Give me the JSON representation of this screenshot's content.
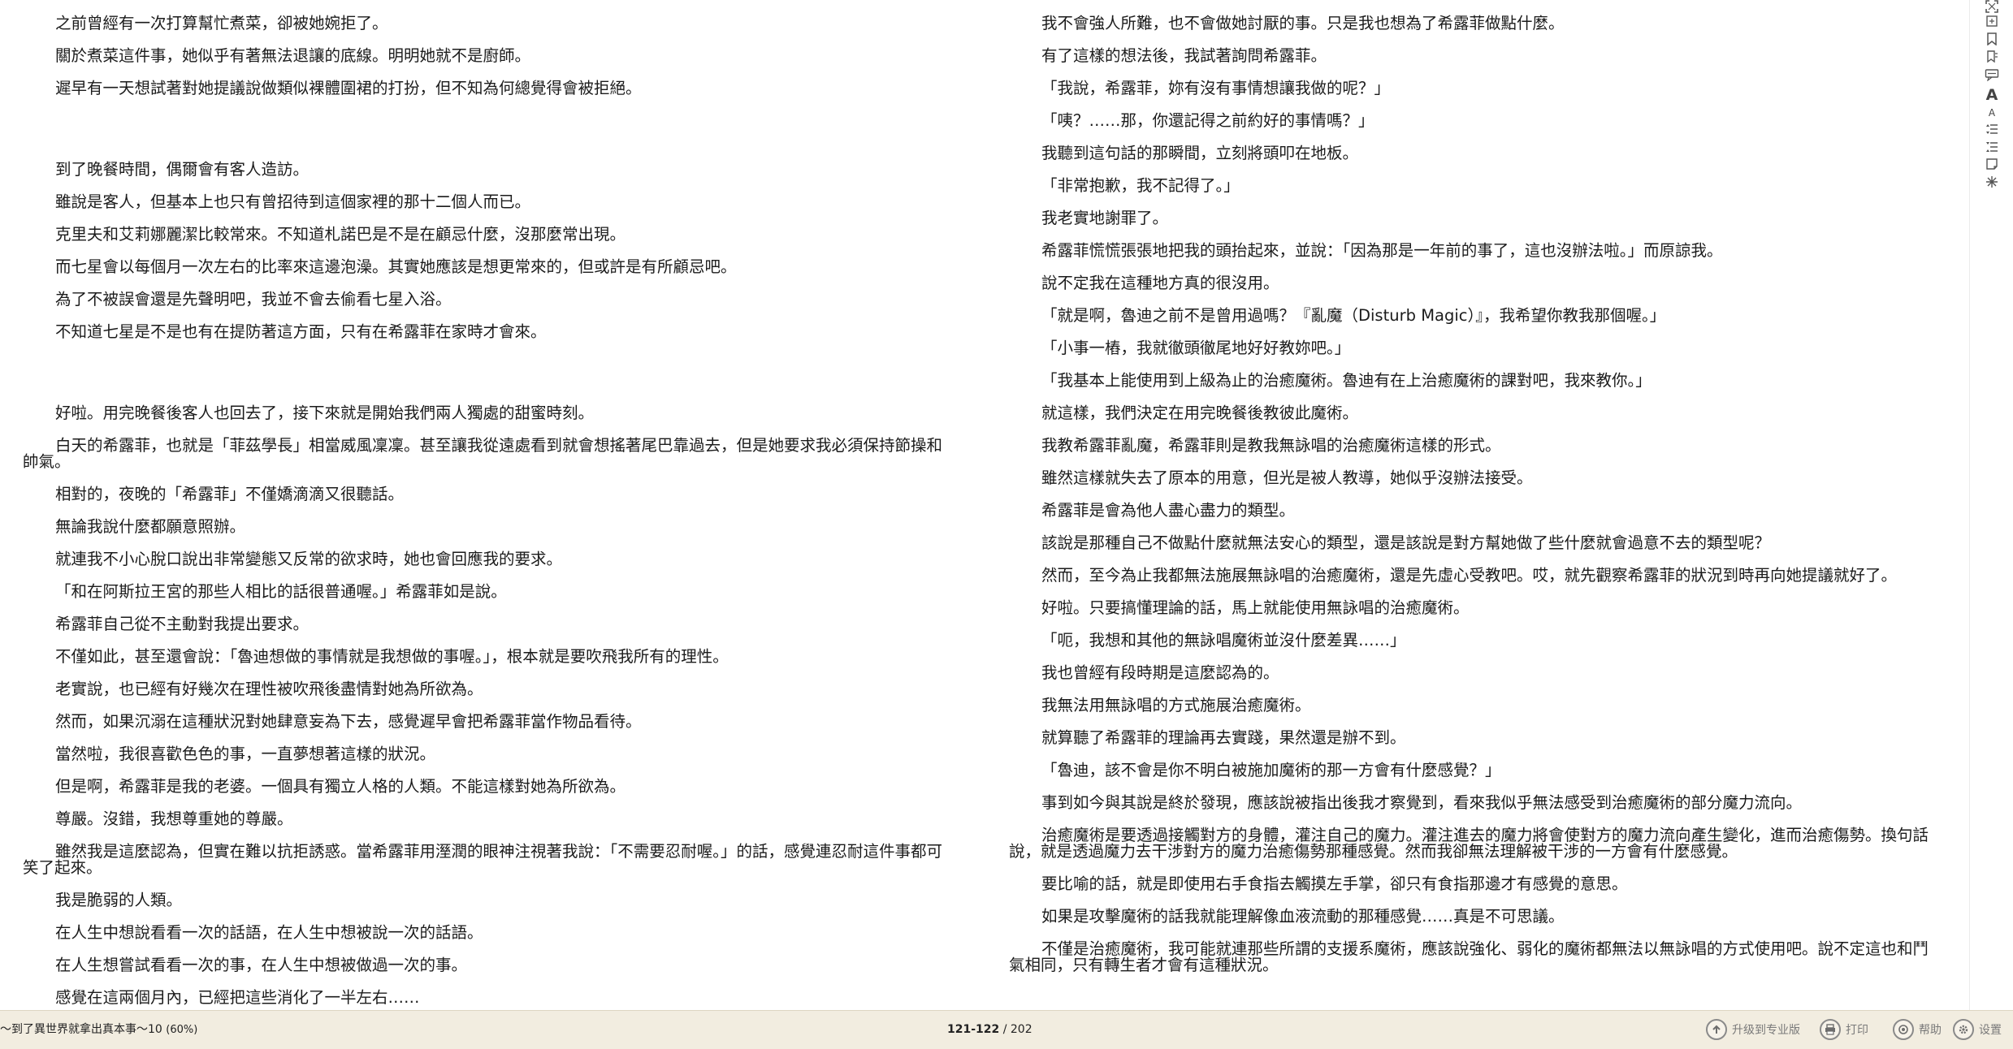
{
  "document": {
    "left_column": [
      "之前曾經有一次打算幫忙煮菜，卻被她婉拒了。",
      "關於煮菜這件事，她似乎有著無法退讓的底線。明明她就不是廚師。",
      "遲早有一天想試著對她提議說做類似裸體圍裙的打扮，但不知為何總覺得會被拒絕。",
      "",
      "到了晚餐時間，偶爾會有客人造訪。",
      "雖說是客人，但基本上也只有曾招待到這個家裡的那十二個人而已。",
      "克里夫和艾莉娜麗潔比較常來。不知道札諾巴是不是在顧忌什麼，沒那麼常出現。",
      "而七星會以每個月一次左右的比率來這邊泡澡。其實她應該是想更常來的，但或許是有所顧忌吧。",
      "為了不被誤會還是先聲明吧，我並不會去偷看七星入浴。",
      "不知道七星是不是也有在提防著這方面，只有在希露菲在家時才會來。",
      "",
      "好啦。用完晚餐後客人也回去了，接下來就是開始我們兩人獨處的甜蜜時刻。",
      "白天的希露菲，也就是「菲茲學長」相當威風凜凜。甚至讓我從遠處看到就會想搖著尾巴靠過去，但是她要求我必須保持節操和帥氣。",
      "相對的，夜晚的「希露菲」不僅嬌滴滴又很聽話。",
      "無論我說什麼都願意照辦。",
      "就連我不小心脫口說出非常變態又反常的欲求時，她也會回應我的要求。",
      "「和在阿斯拉王宮的那些人相比的話很普通喔。」希露菲如是說。",
      "希露菲自己從不主動對我提出要求。",
      "不僅如此，甚至還會說：「魯迪想做的事情就是我想做的事喔。」，根本就是要吹飛我所有的理性。",
      "老實說，也已經有好幾次在理性被吹飛後盡情對她為所欲為。",
      "然而，如果沉溺在這種狀況對她肆意妄為下去，感覺遲早會把希露菲當作物品看待。",
      "當然啦，我很喜歡色色的事，一直夢想著這樣的狀況。",
      "但是啊，希露菲是我的老婆。一個具有獨立人格的人類。不能這樣對她為所欲為。",
      "尊嚴。沒錯，我想尊重她的尊嚴。",
      "雖然我是這麼認為，但實在難以抗拒誘惑。當希露菲用溼潤的眼神注視著我說：「不需要忍耐喔。」的話，感覺連忍耐這件事都可笑了起來。",
      "我是脆弱的人類。",
      "在人生中想說看看一次的話語，在人生中想被說一次的話語。",
      "在人生想嘗試看看一次的事，在人生中想被做過一次的事。",
      "感覺在這兩個月內，已經把這些消化了一半左右……"
    ],
    "right_column": [
      "我不會強人所難，也不會做她討厭的事。只是我也想為了希露菲做點什麼。",
      "有了這樣的想法後，我試著詢問希露菲。",
      "「我說，希露菲，妳有沒有事情想讓我做的呢？」",
      "「咦？……那，你還記得之前約好的事情嗎？」",
      "我聽到這句話的那瞬間，立刻將頭叩在地板。",
      "「非常抱歉，我不記得了。」",
      "我老實地謝罪了。",
      "希露菲慌慌張張地把我的頭抬起來，並說：「因為那是一年前的事了，這也沒辦法啦。」而原諒我。",
      "說不定我在這種地方真的很沒用。",
      "「就是啊，魯迪之前不是曾用過嗎？『亂魔（Disturb Magic）』，我希望你教我那個喔。」",
      "「小事一樁，我就徹頭徹尾地好好教妳吧。」",
      "「我基本上能使用到上級為止的治癒魔術。魯迪有在上治癒魔術的課對吧，我來教你。」",
      "就這樣，我們決定在用完晚餐後教彼此魔術。",
      "我教希露菲亂魔，希露菲則是教我無詠唱的治癒魔術這樣的形式。",
      "雖然這樣就失去了原本的用意，但光是被人教導，她似乎沒辦法接受。",
      "希露菲是會為他人盡心盡力的類型。",
      "該說是那種自己不做點什麼就無法安心的類型，還是該說是對方幫她做了些什麼就會過意不去的類型呢？",
      "然而，至今為止我都無法施展無詠唱的治癒魔術，還是先虛心受教吧。哎，就先觀察希露菲的狀況到時再向她提議就好了。",
      "好啦。只要搞懂理論的話，馬上就能使用無詠唱的治癒魔術。",
      "「呃，我想和其他的無詠唱魔術並沒什麼差異……」",
      "我也曾經有段時期是這麼認為的。",
      "我無法用無詠唱的方式施展治癒魔術。",
      "就算聽了希露菲的理論再去實踐，果然還是辦不到。",
      "「魯迪，該不會是你不明白被施加魔術的那一方會有什麼感覺？」",
      "事到如今與其說是終於發現，應該說被指出後我才察覺到，看來我似乎無法感受到治癒魔術的部分魔力流向。",
      "治癒魔術是要透過接觸對方的身體，灌注自己的魔力。灌注進去的魔力將會使對方的魔力流向產生變化，進而治癒傷勢。換句話說，就是透過魔力去干涉對方的魔力治癒傷勢那種感覺。然而我卻無法理解被干涉的一方會有什麼感覺。",
      "要比喻的話，就是即使用右手食指去觸摸左手掌，卻只有食指那邊才有感覺的意思。",
      "如果是攻擊魔術的話我就能理解像血液流動的那種感覺……真是不可思議。",
      "不僅是治癒魔術，我可能就連那些所謂的支援系魔術，應該說強化、弱化的魔術都無法以無詠唱的方式使用吧。說不定這也和鬥氣相同，只有轉生者才會有這種狀況。"
    ]
  },
  "toolbar": {
    "icons": [
      "fullscreen-icon",
      "fit-page-icon",
      "bookmark-icon",
      "bookmark-list-icon",
      "comment-icon",
      "font-larger-icon",
      "font-smaller-icon",
      "line-spacing-increase-icon",
      "line-spacing-decrease-icon",
      "note-icon",
      "settings-star-icon"
    ],
    "font_larger_glyph": "A",
    "font_smaller_glyph": "A"
  },
  "status": {
    "title": "～到了異世界就拿出真本事～10",
    "progress_text": "(60%)",
    "progress_percent": 60,
    "page_range": "121-122",
    "page_sep": " / ",
    "page_total": "202",
    "upgrade_label": "升级到专业版",
    "print_label": "打印",
    "help_label": "帮助",
    "settings_label": "设置"
  }
}
